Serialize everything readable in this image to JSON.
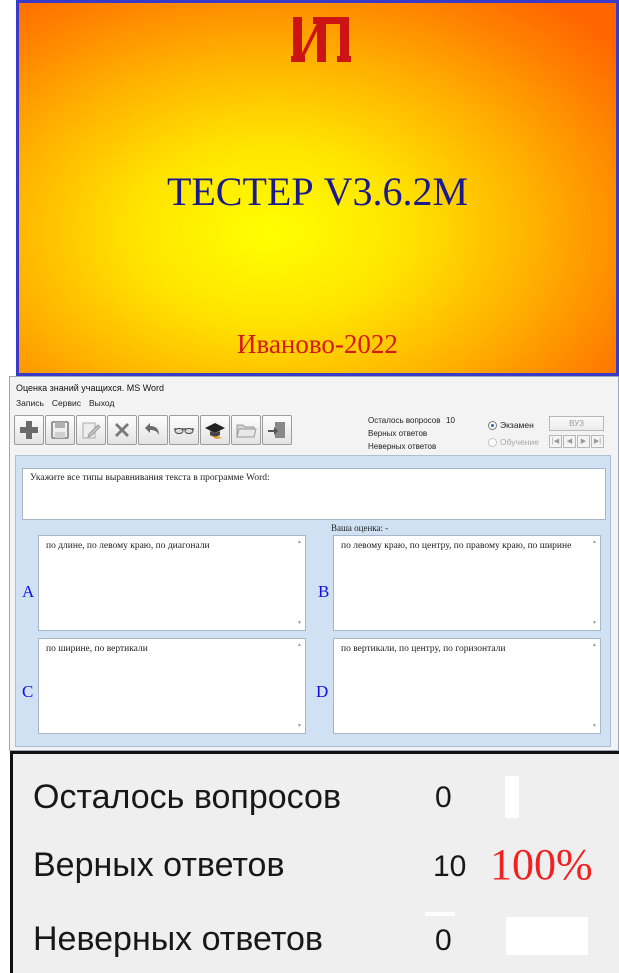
{
  "splash": {
    "logo_text": "ИП",
    "title": "ТЕСТЕР V3.6.2M",
    "footer": "Иваново-2022"
  },
  "window": {
    "title": "Оценка знаний учащихся. MS Word",
    "menu": [
      "Запись",
      "Сервис",
      "Выход"
    ],
    "toolbar_icons": [
      "add-icon",
      "save-icon",
      "edit-icon",
      "delete-icon",
      "undo-icon",
      "glasses-icon",
      "graduation-cap-icon",
      "folder-icon",
      "exit-door-icon"
    ]
  },
  "stats": {
    "remaining_label": "Осталось вопросов",
    "remaining_value": "10",
    "correct_label": "Верных ответов",
    "correct_value": "",
    "wrong_label": "Неверных ответов",
    "wrong_value": ""
  },
  "mode": {
    "exam_label": "Экзамен",
    "exam_selected": true,
    "learning_label": "Обучение",
    "learning_enabled": false
  },
  "vuz_button": "ВУЗ",
  "nav_buttons": [
    "|◀",
    "◀",
    "▶",
    "▶|"
  ],
  "question": "Укажите все типы выравнивания текста в программе Word:",
  "grade_label": "Ваша оценка: -",
  "answers": [
    {
      "letter": "A",
      "text": "по длине, по левому краю, по диагонали"
    },
    {
      "letter": "B",
      "text": "по левому краю, по центру, по правому краю, по ширине"
    },
    {
      "letter": "C",
      "text": "по ширине, по вертикали"
    },
    {
      "letter": "D",
      "text": "по вертикали, по центру, по горизонтали"
    }
  ],
  "zoom_stats": {
    "remaining_label": "Осталось вопросов",
    "remaining_value": "0",
    "correct_label": "Верных ответов",
    "correct_value": "10",
    "correct_percent": "100%",
    "wrong_label": "Неверных ответов",
    "wrong_value": "0"
  },
  "colors": {
    "splash_title": "#1a1a8c",
    "splash_footer": "#d81818",
    "answer_letter": "#1010e0",
    "percent": "#ee2222",
    "panel": "#cfe1f2"
  }
}
